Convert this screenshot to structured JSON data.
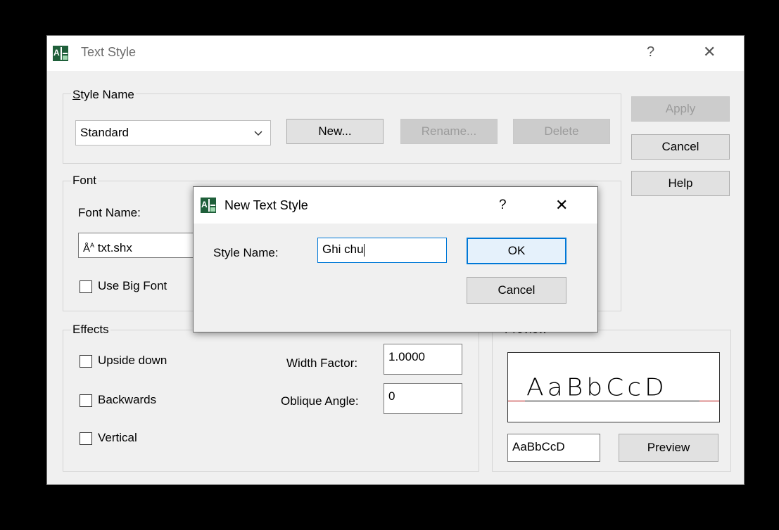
{
  "main_dialog": {
    "title": "Text Style",
    "help_glyph": "?",
    "close_glyph": "✕",
    "icon": "text-style-app-icon"
  },
  "style_name_group": {
    "label": "Style Name",
    "selected_style": "Standard",
    "new_label": "New...",
    "rename_label": "Rename...",
    "delete_label": "Delete"
  },
  "side_buttons": {
    "apply_label": "Apply",
    "cancel_label": "Cancel",
    "help_label": "Help"
  },
  "font_group": {
    "label": "Font",
    "font_name_label": "Font Name:",
    "font_name_value": "txt.shx",
    "font_icon": "shx-font-icon",
    "use_big_font_label": "Use Big Font",
    "use_big_font_checked": false
  },
  "effects_group": {
    "label": "Effects",
    "upside_down_label": "Upside down",
    "backwards_label": "Backwards",
    "vertical_label": "Vertical",
    "width_factor_label": "Width Factor:",
    "width_factor_value": "1.0000",
    "oblique_angle_label": "Oblique Angle:",
    "oblique_angle_value": "0"
  },
  "preview_group": {
    "label": "Preview",
    "preview_text": "AaBbCcD",
    "sample_text": "AaBbCcD",
    "preview_button_label": "Preview"
  },
  "new_style_dialog": {
    "title": "New Text Style",
    "help_glyph": "?",
    "close_glyph": "✕",
    "style_name_label": "Style Name:",
    "style_name_value": "Ghi chu",
    "ok_label": "OK",
    "cancel_label": "Cancel"
  },
  "colors": {
    "preview_baseline": "#b00000",
    "ok_focus_border": "#0078d7",
    "input_focus_border": "#0078d7"
  }
}
